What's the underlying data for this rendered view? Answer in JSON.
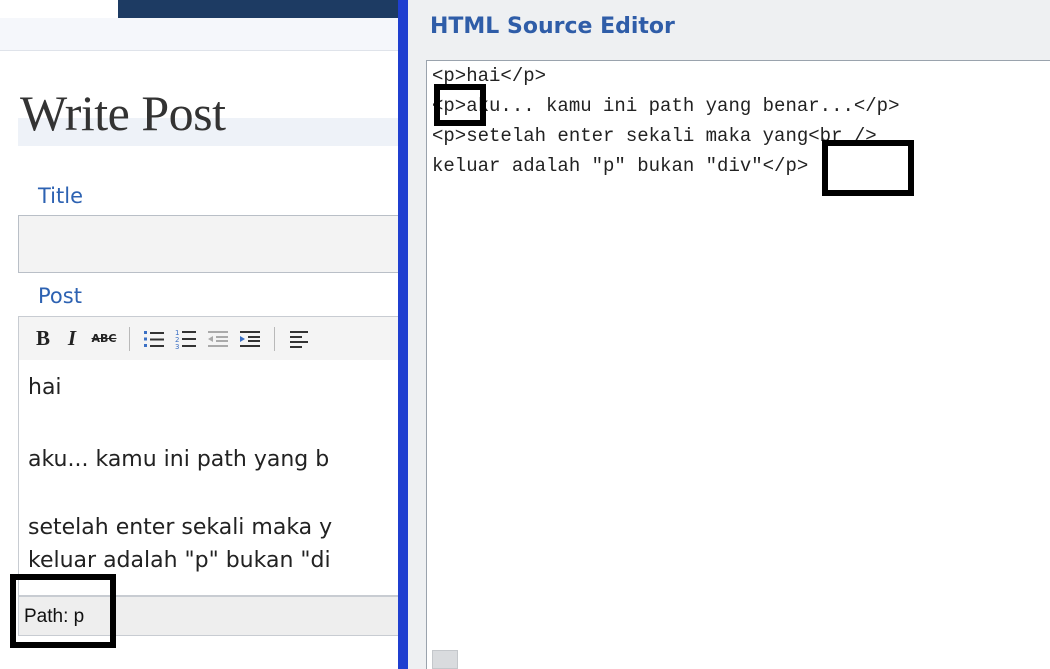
{
  "write_post": {
    "page_title": "Write Post",
    "title_label": "Title",
    "title_value": "",
    "post_label": "Post",
    "toolbar": {
      "bold_label": "B",
      "italic_label": "I",
      "strike_label": "ABC",
      "icons": [
        "bold-icon",
        "italic-icon",
        "strikethrough-icon",
        "bullet-list-icon",
        "numbered-list-icon",
        "outdent-icon",
        "indent-icon",
        "align-left-icon"
      ]
    },
    "editor_paragraphs": [
      "hai",
      "aku... kamu ini path yang b",
      "setelah enter sekali maka y",
      "keluar adalah \"p\" bukan \"di"
    ],
    "path_label": "Path: p"
  },
  "source_editor": {
    "title": "HTML Source Editor",
    "code_lines": [
      "<p>hai</p>",
      "<p>aku... kamu ini path yang benar...</p>",
      "<p>setelah enter sekali maka yang<br />",
      "keluar adalah \"p\" bukan \"div\"</p>"
    ]
  },
  "colors": {
    "label_blue": "#2d62b2",
    "divider_blue": "#1f3fd0",
    "dialog_title_blue": "#2f5da8",
    "highlight": "#000000"
  }
}
